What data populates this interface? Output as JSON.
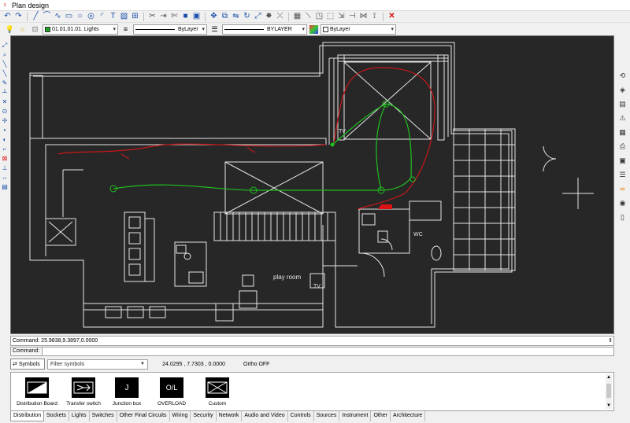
{
  "window": {
    "title": "Plan design"
  },
  "properties": {
    "layer": "01.01.01.01. Lights",
    "layer_color": "#1fa31f",
    "linetype": "ByLayer",
    "lineweight": "BYLAYER",
    "color": "ByLayer"
  },
  "canvas": {
    "labels": {
      "tv_upper": "TV",
      "wc": "WC",
      "play_room": "play room",
      "tv_lower": "TV"
    },
    "colors": {
      "background": "#272727",
      "walls": "#e6e6e6",
      "circuit_red": "#c8181a",
      "circuit_green": "#1fbf1f"
    }
  },
  "command": {
    "history": "Command: 25.9838,9.3897,0.0000",
    "prompt_label": "Command:",
    "input": ""
  },
  "status": {
    "symbols_label": "Symbols",
    "filter_placeholder": "Filter symbols",
    "coordinates": "24.0295 , 7.7303 , 0.0000",
    "ortho": "Ortho OFF"
  },
  "symbols": [
    {
      "label": "Distribution Board",
      "glyph": ""
    },
    {
      "label": "Transfer switch",
      "glyph": ""
    },
    {
      "label": "Junction box",
      "glyph": "J"
    },
    {
      "label": "OVERLOAD",
      "glyph": "O/L"
    },
    {
      "label": "Custom",
      "glyph": ""
    }
  ],
  "tabs": [
    "Distribution",
    "Sockets",
    "Lights",
    "Switches",
    "Other Final Circuits",
    "Wiring",
    "Security",
    "Network",
    "Audio and Video",
    "Controls",
    "Sources",
    "Instrument",
    "Other",
    "Architecture"
  ],
  "active_tab": "Distribution"
}
